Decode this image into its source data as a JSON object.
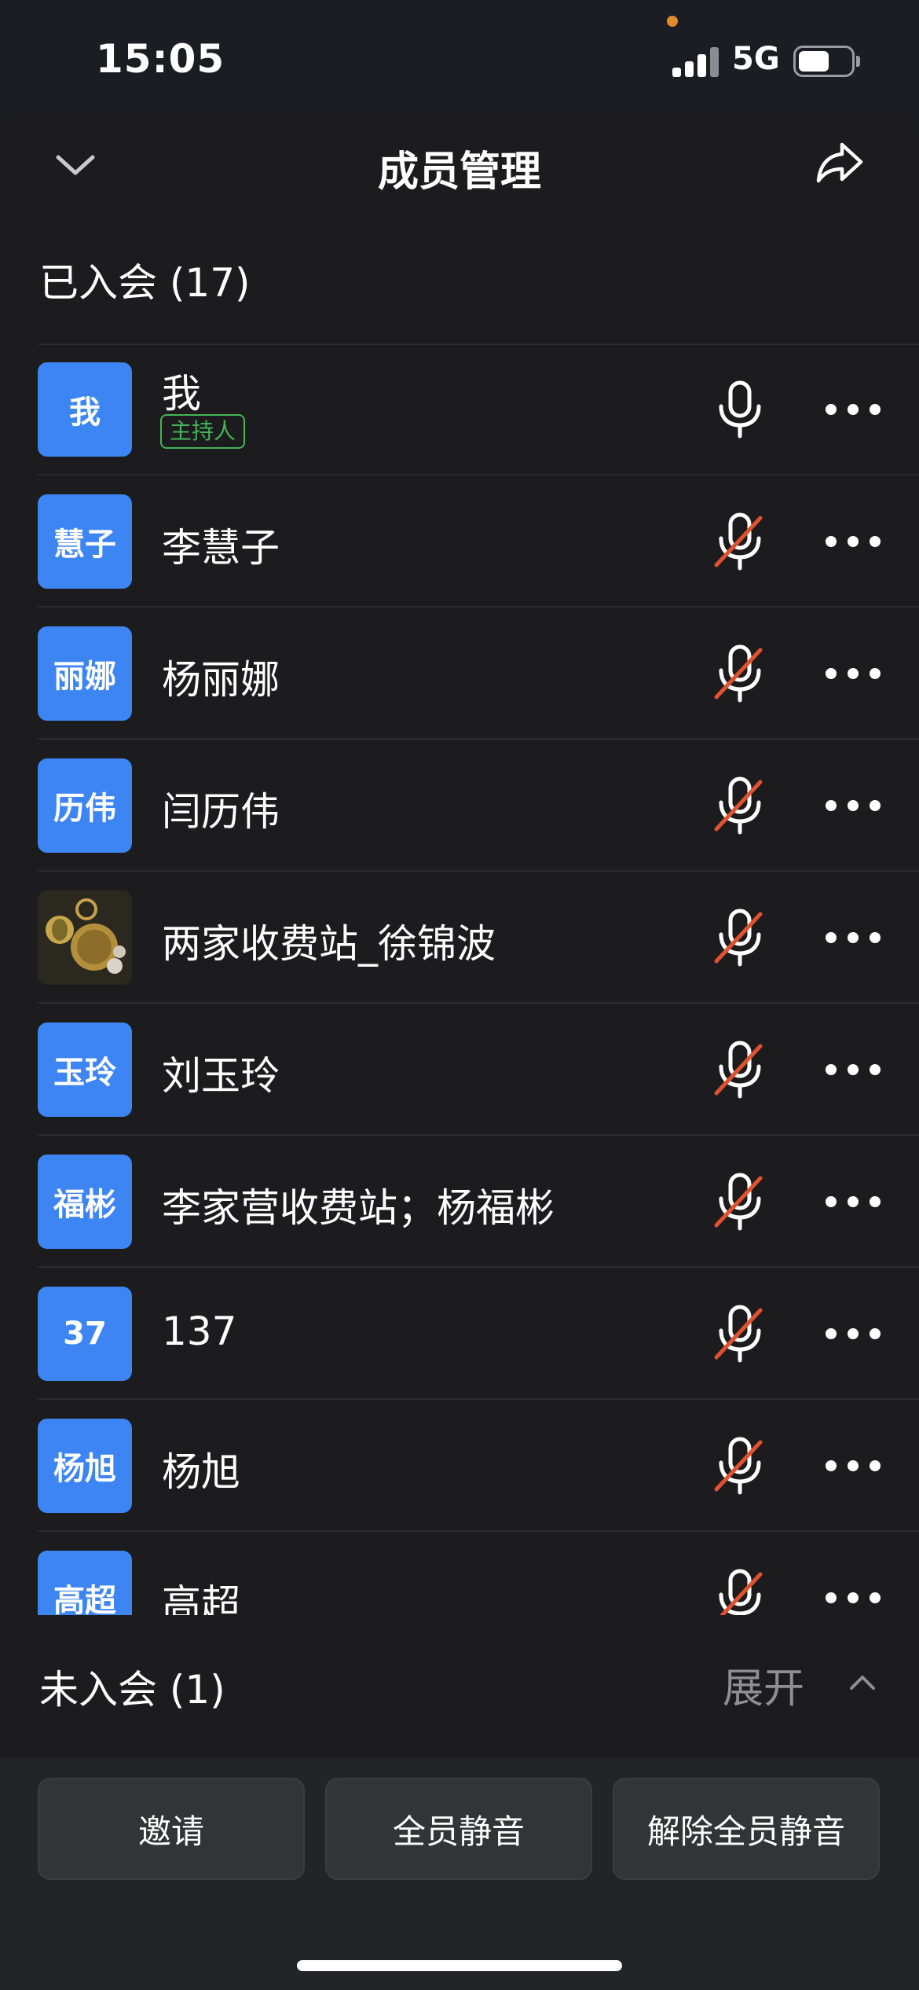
{
  "status_bar": {
    "time": "15:05",
    "network": "5G"
  },
  "nav": {
    "title": "成员管理"
  },
  "joined": {
    "header": "已入会 (17)",
    "members": [
      {
        "avatar_text": "我",
        "name": "我",
        "role": "主持人",
        "mic": "on"
      },
      {
        "avatar_text": "慧子",
        "name": "李慧子",
        "mic": "muted"
      },
      {
        "avatar_text": "丽娜",
        "name": "杨丽娜",
        "mic": "muted"
      },
      {
        "avatar_text": "历伟",
        "name": "闫历伟",
        "mic": "muted"
      },
      {
        "avatar_text": "",
        "name": "两家收费站_徐锦波",
        "mic": "muted",
        "avatar_icon": "keychain-photo-avatar"
      },
      {
        "avatar_text": "玉玲",
        "name": "刘玉玲",
        "mic": "muted"
      },
      {
        "avatar_text": "福彬",
        "name": "李家营收费站；杨福彬",
        "mic": "muted"
      },
      {
        "avatar_text": "37",
        "name": "137",
        "mic": "muted"
      },
      {
        "avatar_text": "杨旭",
        "name": "杨旭",
        "mic": "muted"
      },
      {
        "avatar_text": "高超",
        "name": "高超",
        "mic": "muted"
      }
    ]
  },
  "not_joined": {
    "header": "未入会 (1)",
    "expand_label": "展开"
  },
  "actions": {
    "invite": "邀请",
    "mute_all": "全员静音",
    "unmute_all": "解除全员静音"
  },
  "colors": {
    "accent_blue": "#3d85f3",
    "muted_red": "#e2512f",
    "host_green": "#44b45a"
  }
}
